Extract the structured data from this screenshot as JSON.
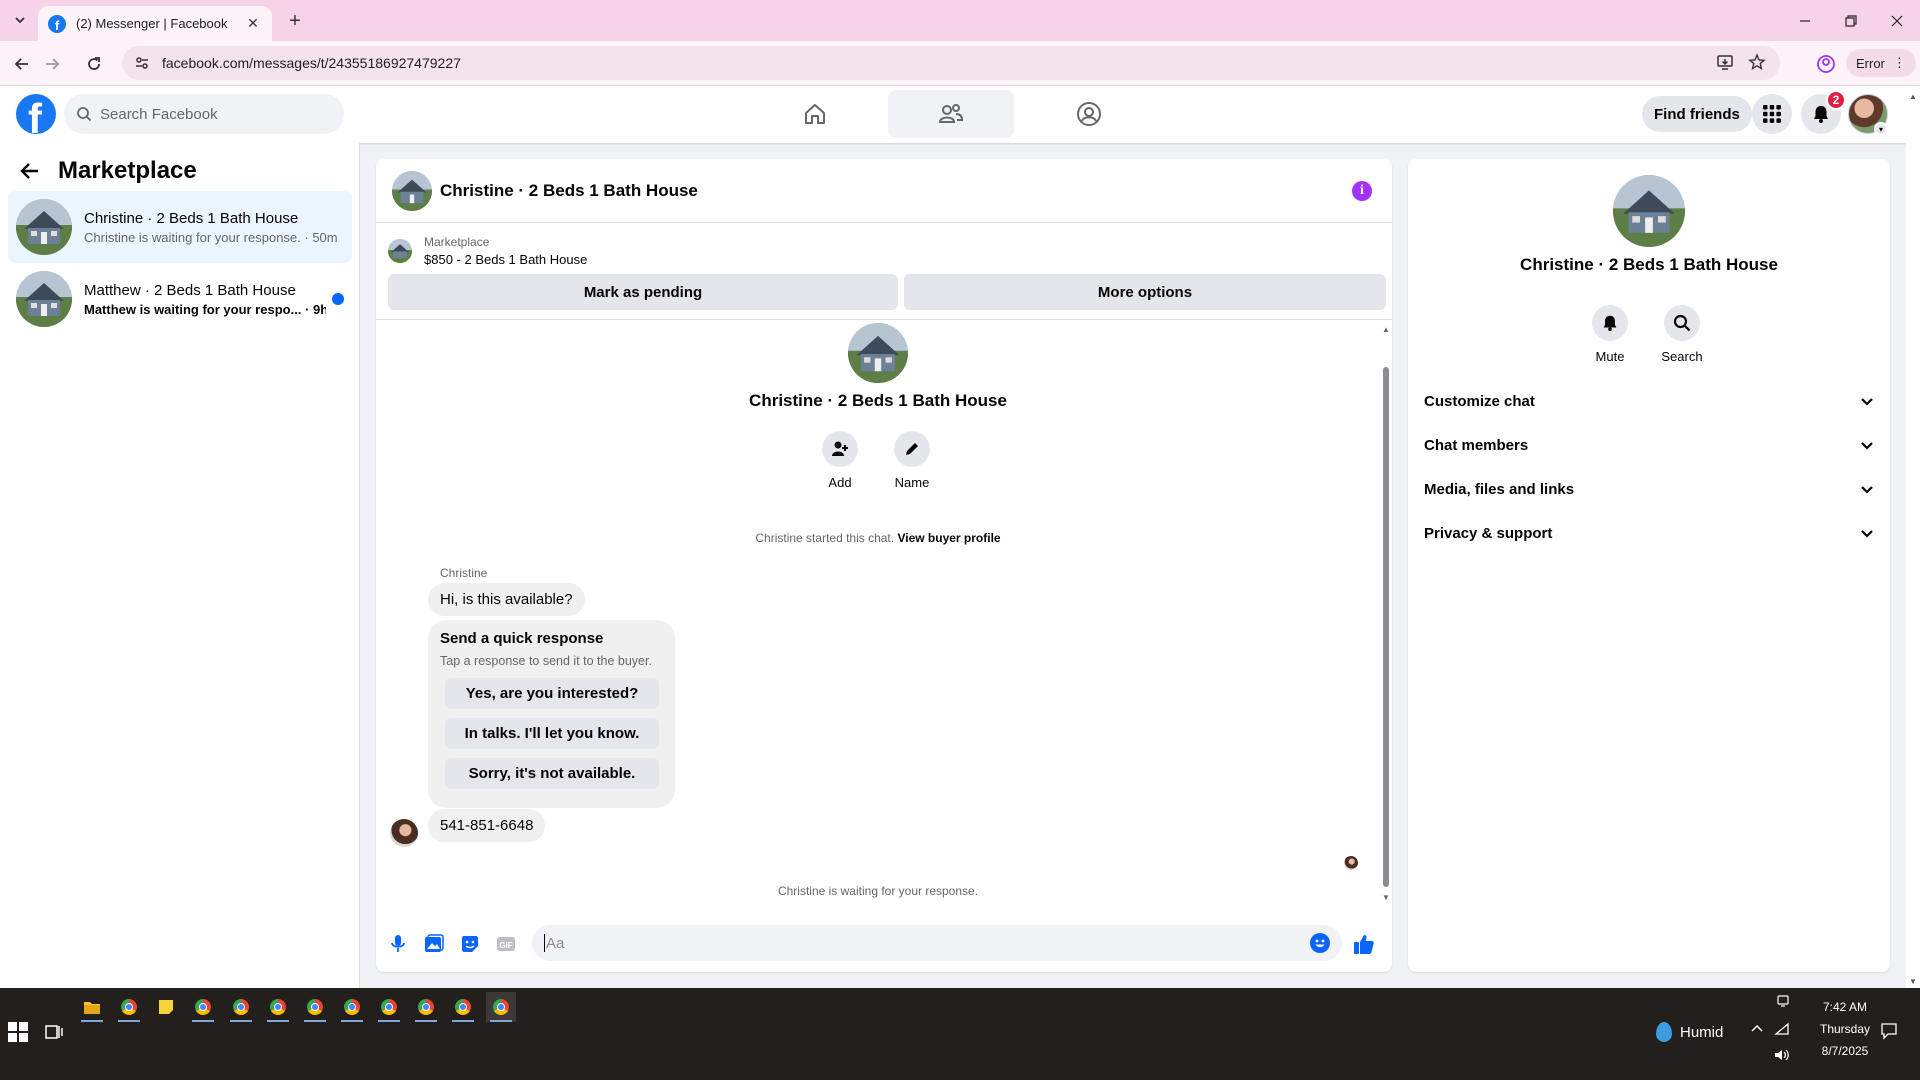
{
  "browser": {
    "tab_title": "(2) Messenger | Facebook",
    "url": "facebook.com/messages/t/24355186927479227",
    "profile_chip": "Error"
  },
  "header": {
    "search_placeholder": "Search Facebook",
    "find_friends_label": "Find friends",
    "notification_count": "2"
  },
  "sidebar": {
    "title": "Marketplace",
    "conversations": [
      {
        "name": "Christine · 2 Beds 1 Bath House",
        "preview": "Christine is waiting for your response. · 50m",
        "active": true,
        "unread": false
      },
      {
        "name": "Matthew · 2 Beds 1 Bath House",
        "preview": "Matthew is waiting for your respo... · 9h",
        "active": false,
        "unread": true
      }
    ]
  },
  "chat": {
    "title": "Christine · 2 Beds 1 Bath House",
    "listing_category": "Marketplace",
    "listing_price": "$850 - 2 Beds 1 Bath House",
    "mark_pending_label": "Mark as pending",
    "more_options_label": "More options",
    "intro_name": "Christine · 2 Beds 1 Bath House",
    "add_label": "Add",
    "name_label": "Name",
    "started_note": "Christine started this chat.",
    "view_buyer_profile": "View buyer profile",
    "sender_name": "Christine",
    "first_message": "Hi, is this available?",
    "quick_response_title": "Send a quick response",
    "quick_response_sub": "Tap a response to send it to the buyer.",
    "quick_responses": [
      "Yes, are you interested?",
      "In talks. I'll let you know.",
      "Sorry, it's not available."
    ],
    "phone_message": "541-851-6648",
    "waiting_note": "Christine is waiting for your response.",
    "composer_placeholder": "Aa"
  },
  "details": {
    "name": "Christine · 2 Beds 1 Bath House",
    "mute_label": "Mute",
    "search_label": "Search",
    "sections": [
      "Customize chat",
      "Chat members",
      "Media, files and links",
      "Privacy & support"
    ]
  },
  "taskbar": {
    "weather": "Humid",
    "time": "7:42 AM",
    "day": "Thursday",
    "date": "8/7/2025"
  },
  "colors": {
    "fb_blue": "#1877f2",
    "messenger_blue": "#0866ff",
    "accent_purple": "#a033ff",
    "tabbar_pink": "#f6d3e6"
  }
}
